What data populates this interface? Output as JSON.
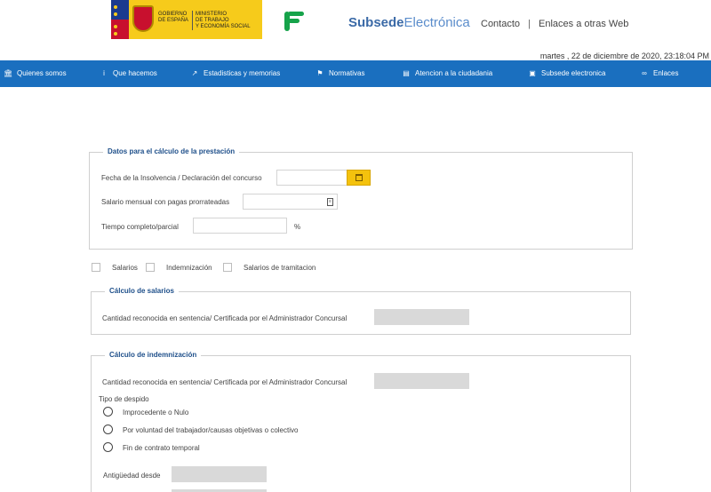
{
  "header": {
    "gov_text_left": "GOBIERNO\nDE ESPAÑA",
    "gov_text_right": "MINISTERIO\nDE TRABAJO\nY ECONOMÍA SOCIAL",
    "brand_part1": "Subsede",
    "brand_part2": "Electrónica",
    "link_contact": "Contacto",
    "link_separator": "|",
    "link_other": "Enlaces a otras Web",
    "datetime": "martes , 22 de diciembre de 2020,  23:18:04 PM"
  },
  "nav": {
    "items": [
      {
        "label": "Quienes somos",
        "icon": "institution-icon"
      },
      {
        "label": "Que hacemos",
        "icon": "info-icon"
      },
      {
        "label": "Estadisticas y memorias",
        "icon": "stats-icon"
      },
      {
        "label": "Normativas",
        "icon": "pin-icon"
      },
      {
        "label": "Atencion a la ciudadania",
        "icon": "book-icon"
      },
      {
        "label": "Subsede electronica",
        "icon": "monitor-icon"
      },
      {
        "label": "Enlaces",
        "icon": "link-icon"
      }
    ],
    "color": "#1a6fbf"
  },
  "datos": {
    "legend": "Datos para el cálculo de la prestación",
    "fecha_label": "Fecha de la Insolvencia / Declaración del concurso",
    "fecha_value": "",
    "salario_label": "Salario mensual con pagas prorrateadas",
    "salario_value": "",
    "tiempo_label": "Tiempo completo/parcial",
    "tiempo_value": "",
    "percent": "%"
  },
  "checks": {
    "salarios": "Salarios",
    "indemnizacion": "Indemnización",
    "tramitacion": "Salarios de tramitacion"
  },
  "salarios": {
    "legend": "Cálculo de salarios",
    "cantidad_label": "Cantidad reconocida en sentencia/ Certificada por el Administrador Concursal"
  },
  "indemnizacion": {
    "legend": "Cálculo de indemnización",
    "cantidad_label": "Cantidad reconocida en sentencia/ Certificada por el Administrador Concursal",
    "tipo_label": "Tipo de despido",
    "options": [
      "Improcedente o Nulo",
      "Por voluntad del trabajador/causas objetivas o colectivo",
      "Fin de contrato temporal"
    ],
    "antiguedad_label": "Antigüedad desde"
  },
  "colors": {
    "accent_yellow": "#f4c20d",
    "nav_blue": "#1a6fbf",
    "legend_blue": "#1e4f8a"
  }
}
